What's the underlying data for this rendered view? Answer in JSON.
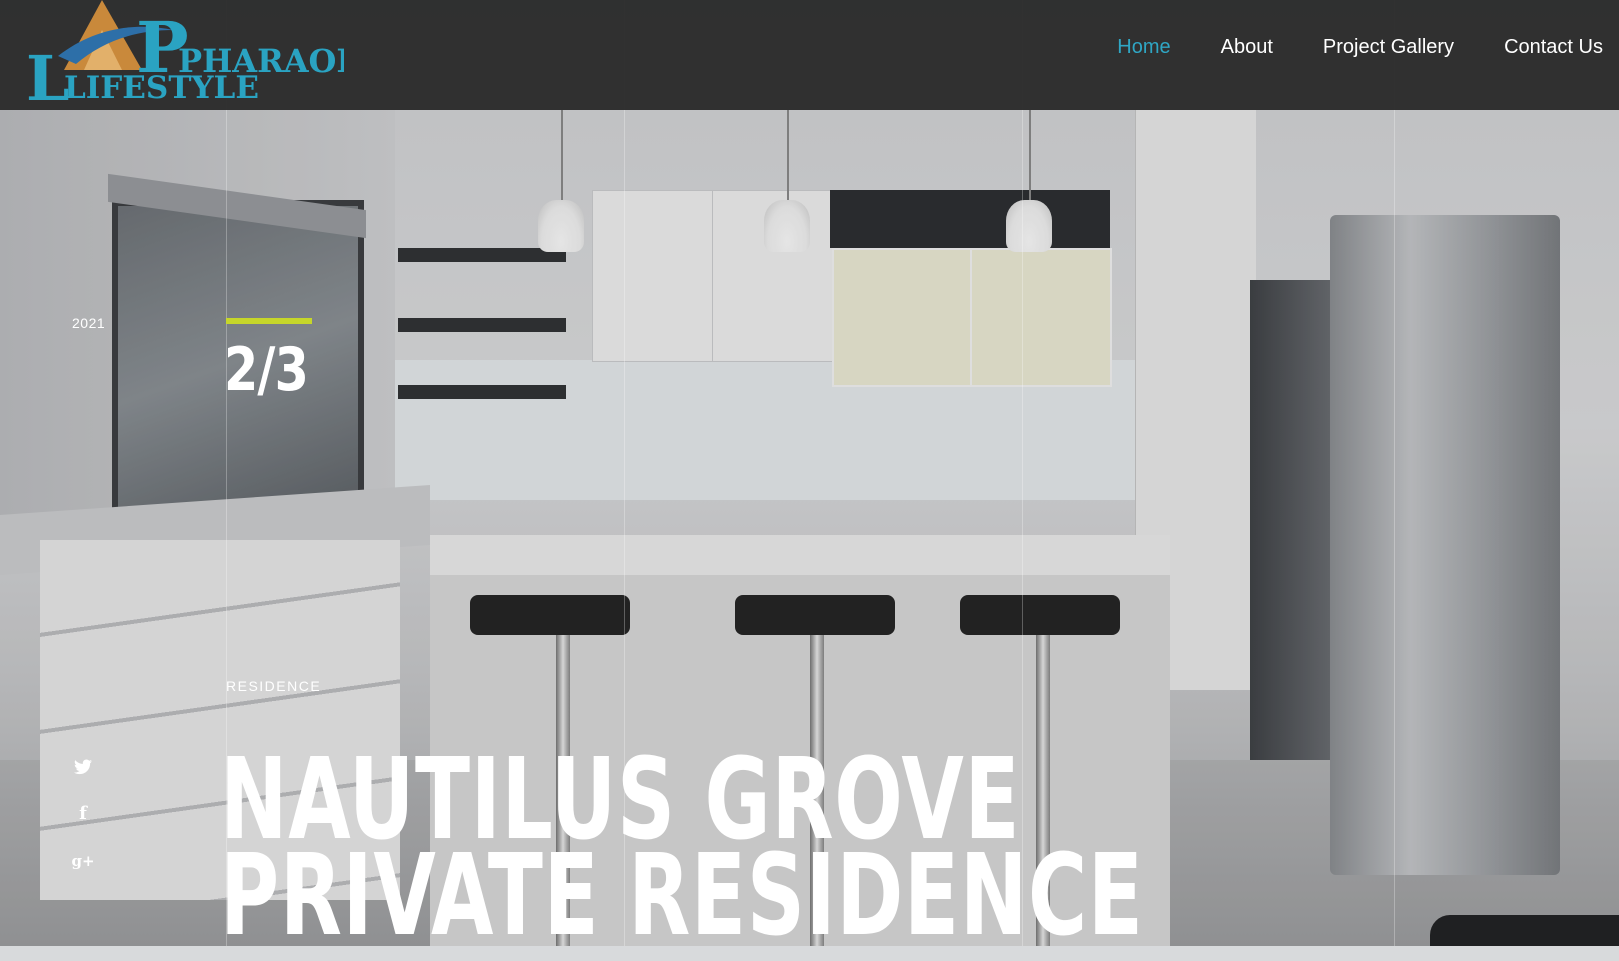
{
  "brand": {
    "logo_line1": "PHARAOHS",
    "logo_line2": "LIFESTYLE",
    "colors": {
      "logo_teal": "#2aa3c2",
      "pyramid_gold": "#c9893b"
    }
  },
  "nav": {
    "items": [
      {
        "label": "Home",
        "active": true
      },
      {
        "label": "About",
        "active": false
      },
      {
        "label": "Project Gallery",
        "active": false
      },
      {
        "label": "Contact Us",
        "active": false
      }
    ],
    "colors": {
      "active": "#2fa6c4",
      "default": "#ffffff"
    }
  },
  "slide": {
    "year": "2021",
    "counter": "2/3",
    "current": 2,
    "total": 3,
    "category": "RESIDENCE",
    "title_line1": "NAUTILUS GROVE",
    "title_line2": "PRIVATE RESIDENCE",
    "accent_color": "#c6d62a"
  },
  "social": {
    "items": [
      {
        "icon": "twitter-icon"
      },
      {
        "icon": "facebook-icon",
        "glyph": "f"
      },
      {
        "icon": "google-plus-icon",
        "glyph": "g+"
      }
    ]
  },
  "colors": {
    "header_bg": "#262626",
    "text": "#ffffff"
  }
}
